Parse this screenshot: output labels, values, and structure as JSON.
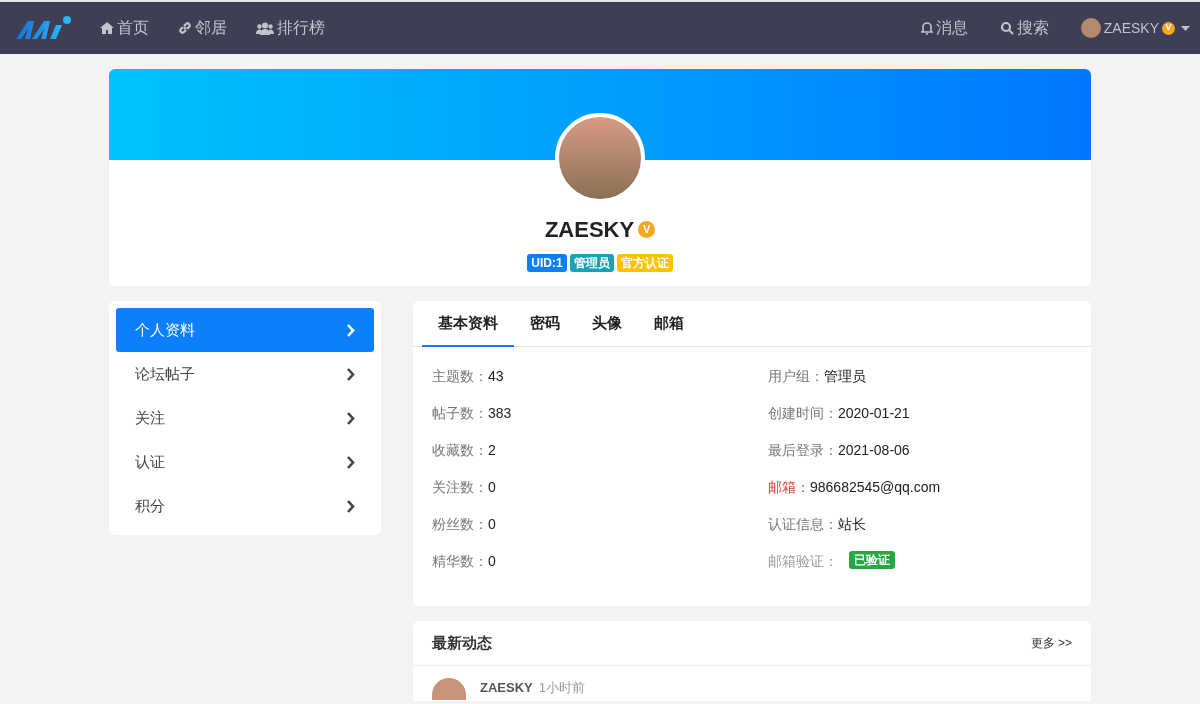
{
  "nav": {
    "items": [
      {
        "kind": "home",
        "label": "首页"
      },
      {
        "kind": "link",
        "label": "邻居"
      },
      {
        "kind": "users",
        "label": "排行榜"
      }
    ],
    "right": [
      {
        "kind": "bell",
        "label": "消息"
      },
      {
        "kind": "search",
        "label": "搜索"
      }
    ],
    "user": {
      "name": "ZAESKY",
      "verified_badge": "V"
    }
  },
  "profile": {
    "name": "ZAESKY",
    "verified_badge": "V",
    "badges": [
      {
        "label": "UID:1",
        "color": "#0d7ffb"
      },
      {
        "label": "管理员",
        "color": "#17a2b8"
      },
      {
        "label": "官方认证",
        "color": "#ffc107"
      }
    ]
  },
  "sidebar": {
    "items": [
      {
        "label": "个人资料",
        "selected": true
      },
      {
        "label": "论坛帖子",
        "selected": false
      },
      {
        "label": "关注",
        "selected": false
      },
      {
        "label": "认证",
        "selected": false
      },
      {
        "label": "积分",
        "selected": false
      }
    ]
  },
  "tabs": [
    {
      "label": "基本资料",
      "selected": true
    },
    {
      "label": "密码",
      "selected": false
    },
    {
      "label": "头像",
      "selected": false
    },
    {
      "label": "邮箱",
      "selected": false
    }
  ],
  "stats_left": [
    {
      "label": "主题数：",
      "value": "43"
    },
    {
      "label": "帖子数：",
      "value": "383"
    },
    {
      "label": "收藏数：",
      "value": "2"
    },
    {
      "label": "关注数：",
      "value": "0"
    },
    {
      "label": "粉丝数：",
      "value": "0"
    },
    {
      "label": "精华数：",
      "value": "0"
    }
  ],
  "stats_right": [
    {
      "kind": "text",
      "label": "用户组：",
      "value": "管理员"
    },
    {
      "kind": "text",
      "label": "创建时间：",
      "value": "2020-01-21"
    },
    {
      "kind": "text",
      "label": "最后登录：",
      "value": "2021-08-06"
    },
    {
      "kind": "alert",
      "label": "邮箱：",
      "value": "986682545@qq.com"
    },
    {
      "kind": "text",
      "label": "认证信息：",
      "value": "站长"
    },
    {
      "kind": "badge",
      "label": "邮箱验证：",
      "value": "已验证"
    }
  ],
  "recent": {
    "title": "最新动态",
    "more": "更多 >>",
    "items": [
      {
        "user": "ZAESKY",
        "time": "1小时前"
      }
    ]
  }
}
